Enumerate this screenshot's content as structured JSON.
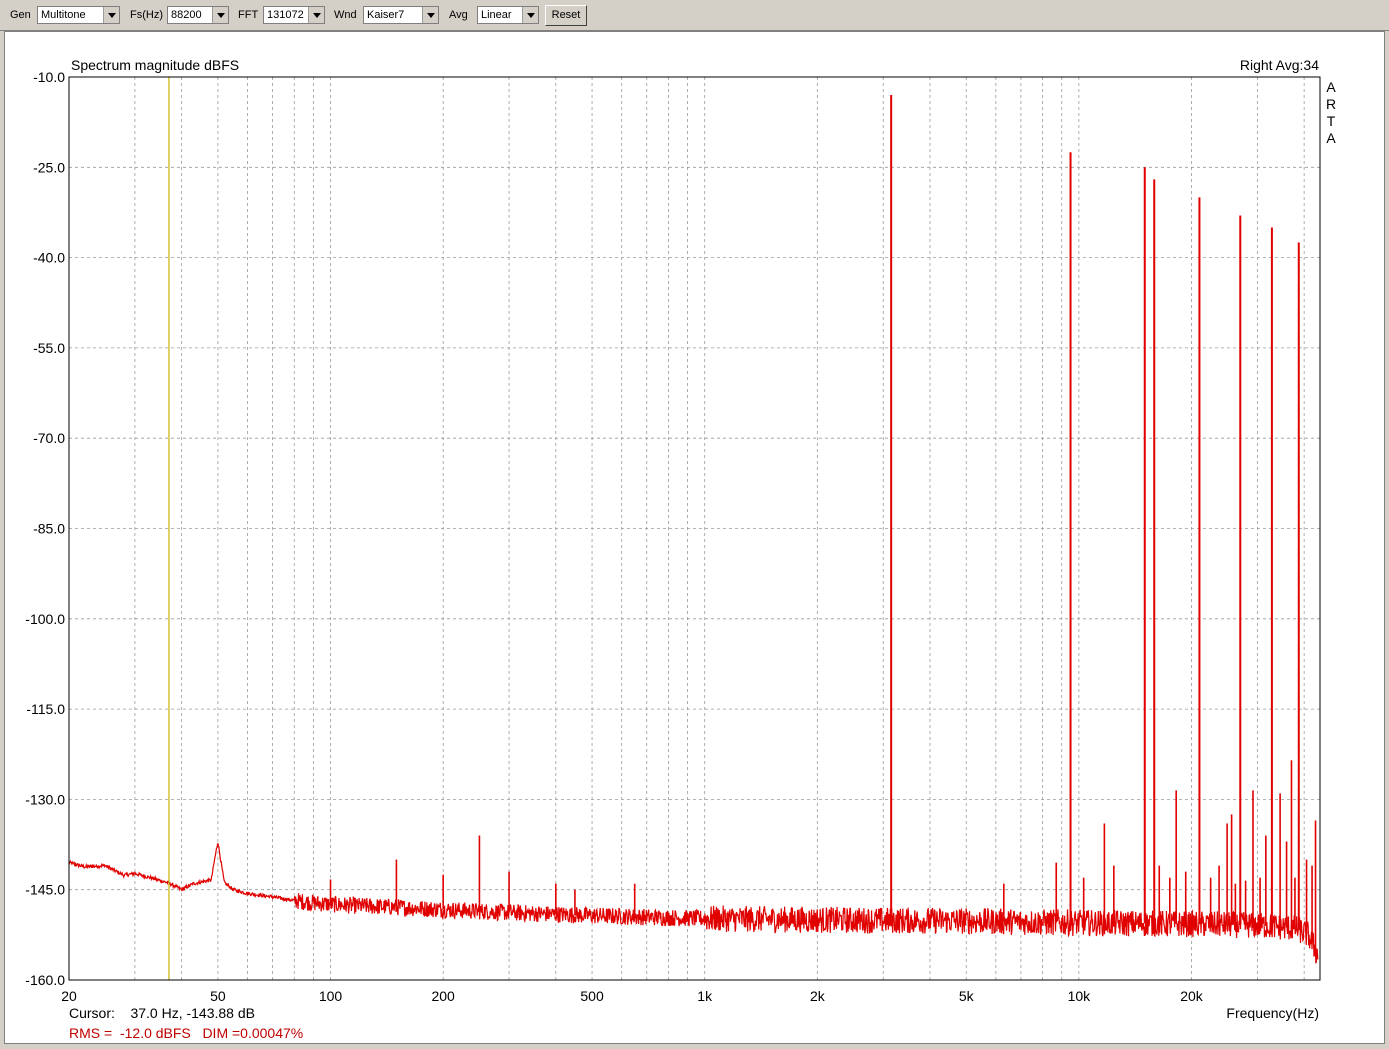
{
  "toolbar": {
    "gen": {
      "label": "Gen",
      "value": "Multitone"
    },
    "fs": {
      "label": "Fs(Hz)",
      "value": "88200"
    },
    "fft": {
      "label": "FFT",
      "value": "131072"
    },
    "wnd": {
      "label": "Wnd",
      "value": "Kaiser7"
    },
    "avg": {
      "label": "Avg",
      "value": "Linear"
    },
    "reset_label": "Reset"
  },
  "chart_data": {
    "type": "line",
    "title": "Spectrum magnitude dBFS",
    "channel_info": "Right  Avg:34",
    "brand_letters": [
      "A",
      "R",
      "T",
      "A"
    ],
    "xlabel": "Frequency(Hz)",
    "ylabel": "",
    "x_scale": "log",
    "xlim": [
      20,
      44100
    ],
    "ylim": [
      -160,
      -10
    ],
    "x_ticks": [
      {
        "value": 20,
        "label": "20"
      },
      {
        "value": 50,
        "label": "50"
      },
      {
        "value": 100,
        "label": "100"
      },
      {
        "value": 200,
        "label": "200"
      },
      {
        "value": 500,
        "label": "500"
      },
      {
        "value": 1000,
        "label": "1k"
      },
      {
        "value": 2000,
        "label": "2k"
      },
      {
        "value": 5000,
        "label": "5k"
      },
      {
        "value": 10000,
        "label": "10k"
      },
      {
        "value": 20000,
        "label": "20k"
      }
    ],
    "y_ticks": [
      {
        "value": -10,
        "label": "-10.0"
      },
      {
        "value": -25,
        "label": "-25.0"
      },
      {
        "value": -40,
        "label": "-40.0"
      },
      {
        "value": -55,
        "label": "-55.0"
      },
      {
        "value": -70,
        "label": "-70.0"
      },
      {
        "value": -85,
        "label": "-85.0"
      },
      {
        "value": -100,
        "label": "-100.0"
      },
      {
        "value": -115,
        "label": "-115.0"
      },
      {
        "value": -130,
        "label": "-130.0"
      },
      {
        "value": -145,
        "label": "-145.0"
      },
      {
        "value": -160,
        "label": "-160.0"
      }
    ],
    "grid": true,
    "colors": {
      "trace": "#e00000",
      "cursor": "#c8b400",
      "grid": "#9a9a9a",
      "rms_text": "#c00000"
    },
    "cursor_freq": 37.0,
    "cursor_text": "Cursor:    37.0 Hz, -143.88 dB",
    "rms_text": "RMS =  -12.0 dBFS   DIM =0.00047%",
    "noise_floor": [
      [
        20,
        -140.5
      ],
      [
        22,
        -141.2
      ],
      [
        25,
        -141.0
      ],
      [
        28,
        -142.6
      ],
      [
        30,
        -142.3
      ],
      [
        33,
        -143.0
      ],
      [
        37,
        -143.9
      ],
      [
        40,
        -145.0
      ],
      [
        43,
        -144.0
      ],
      [
        46,
        -143.6
      ],
      [
        48,
        -143.4
      ],
      [
        49,
        -140.0
      ],
      [
        50,
        -137.0
      ],
      [
        51,
        -140.5
      ],
      [
        52,
        -143.8
      ],
      [
        55,
        -145.0
      ],
      [
        60,
        -145.6
      ],
      [
        70,
        -146.2
      ],
      [
        80,
        -146.8
      ],
      [
        90,
        -147.2
      ],
      [
        100,
        -147.4
      ],
      [
        120,
        -147.7
      ],
      [
        150,
        -147.9
      ],
      [
        200,
        -148.3
      ],
      [
        300,
        -148.8
      ],
      [
        500,
        -149.3
      ],
      [
        1000,
        -149.8
      ],
      [
        2000,
        -150.0
      ],
      [
        3000,
        -150.1
      ],
      [
        5000,
        -150.2
      ],
      [
        10000,
        -150.5
      ],
      [
        20000,
        -150.7
      ],
      [
        30000,
        -150.9
      ],
      [
        38000,
        -151.4
      ],
      [
        41000,
        -152.5
      ],
      [
        42500,
        -154.5
      ],
      [
        43500,
        -156.0
      ]
    ],
    "tones": [
      {
        "freq": 3150,
        "db": -13.0
      },
      {
        "freq": 9500,
        "db": -22.5
      },
      {
        "freq": 15000,
        "db": -25.0
      },
      {
        "freq": 15900,
        "db": -27.0
      },
      {
        "freq": 21000,
        "db": -30.0
      },
      {
        "freq": 27000,
        "db": -33.0
      },
      {
        "freq": 32800,
        "db": -35.0
      },
      {
        "freq": 38700,
        "db": -37.5
      }
    ],
    "spurs": [
      {
        "freq": 100,
        "db": -143.3
      },
      {
        "freq": 150,
        "db": -140.0
      },
      {
        "freq": 200,
        "db": -142.5
      },
      {
        "freq": 250,
        "db": -136.0
      },
      {
        "freq": 300,
        "db": -142.0
      },
      {
        "freq": 400,
        "db": -144.0
      },
      {
        "freq": 450,
        "db": -145.0
      },
      {
        "freq": 650,
        "db": -144.0
      },
      {
        "freq": 6300,
        "db": -144.0
      },
      {
        "freq": 8700,
        "db": -140.5
      },
      {
        "freq": 10300,
        "db": -143.0
      },
      {
        "freq": 11700,
        "db": -134.0
      },
      {
        "freq": 12400,
        "db": -141.0
      },
      {
        "freq": 16400,
        "db": -141.0
      },
      {
        "freq": 17500,
        "db": -143.0
      },
      {
        "freq": 18200,
        "db": -128.5
      },
      {
        "freq": 19300,
        "db": -142.0
      },
      {
        "freq": 22500,
        "db": -143.0
      },
      {
        "freq": 23700,
        "db": -141.0
      },
      {
        "freq": 24900,
        "db": -134.0
      },
      {
        "freq": 25600,
        "db": -132.5
      },
      {
        "freq": 26200,
        "db": -144.0
      },
      {
        "freq": 27900,
        "db": -143.5
      },
      {
        "freq": 29200,
        "db": -128.5
      },
      {
        "freq": 30500,
        "db": -143.0
      },
      {
        "freq": 31600,
        "db": -136.0
      },
      {
        "freq": 34500,
        "db": -129.0
      },
      {
        "freq": 35900,
        "db": -137.0
      },
      {
        "freq": 37000,
        "db": -123.5
      },
      {
        "freq": 37800,
        "db": -143.0
      },
      {
        "freq": 40600,
        "db": -140.0
      },
      {
        "freq": 42000,
        "db": -141.0
      },
      {
        "freq": 42900,
        "db": -133.5
      }
    ]
  }
}
